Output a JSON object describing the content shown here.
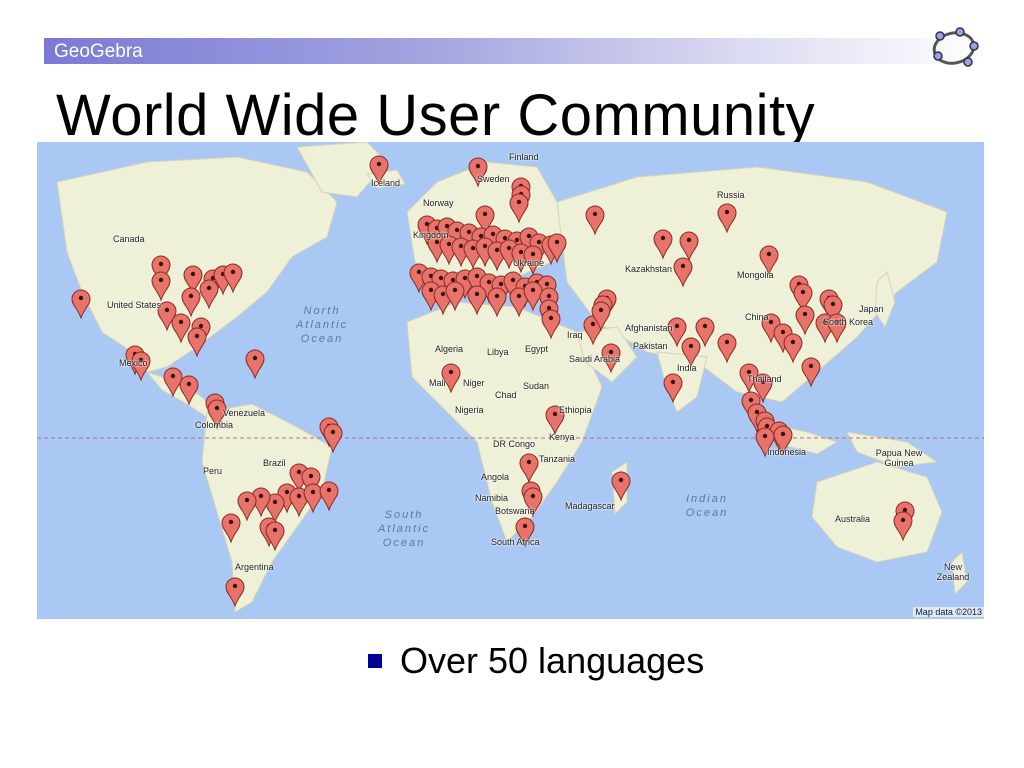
{
  "header": {
    "brand": "GeoGebra",
    "logo_icon": "geogebra-logo-icon"
  },
  "title": "World Wide User Community",
  "bullet": {
    "text": "Over 50 languages",
    "marker_color": "#000099"
  },
  "map": {
    "attribution": "Map data ©2013",
    "marker_icon": "map-pin-icon",
    "marker_color": "#e8736a",
    "labels": [
      "Iceland",
      "Finland",
      "Sweden",
      "Norway",
      "Kingdom",
      "Ukraine",
      "Russia",
      "Kazakhstan",
      "Mongolia",
      "Canada",
      "United States",
      "Mexico",
      "Venezuela",
      "Colombia",
      "Peru",
      "Brazil",
      "Argentina",
      "Algeria",
      "Libya",
      "Egypt",
      "Mali",
      "Niger",
      "Chad",
      "Sudan",
      "Nigeria",
      "Ethiopia",
      "Kenya",
      "Tanzania",
      "DR Congo",
      "Angola",
      "Namibia",
      "Botswana",
      "South Africa",
      "Madagascar",
      "Saudi Arabia",
      "Iraq",
      "Afghanistan",
      "Pakistan",
      "India",
      "Thailand",
      "China",
      "South Korea",
      "Japan",
      "Indonesia",
      "Papua New Guinea",
      "Australia",
      "New Zealand"
    ],
    "oceans": [
      "North Atlantic Ocean",
      "South Atlantic Ocean",
      "Indian Ocean"
    ]
  }
}
